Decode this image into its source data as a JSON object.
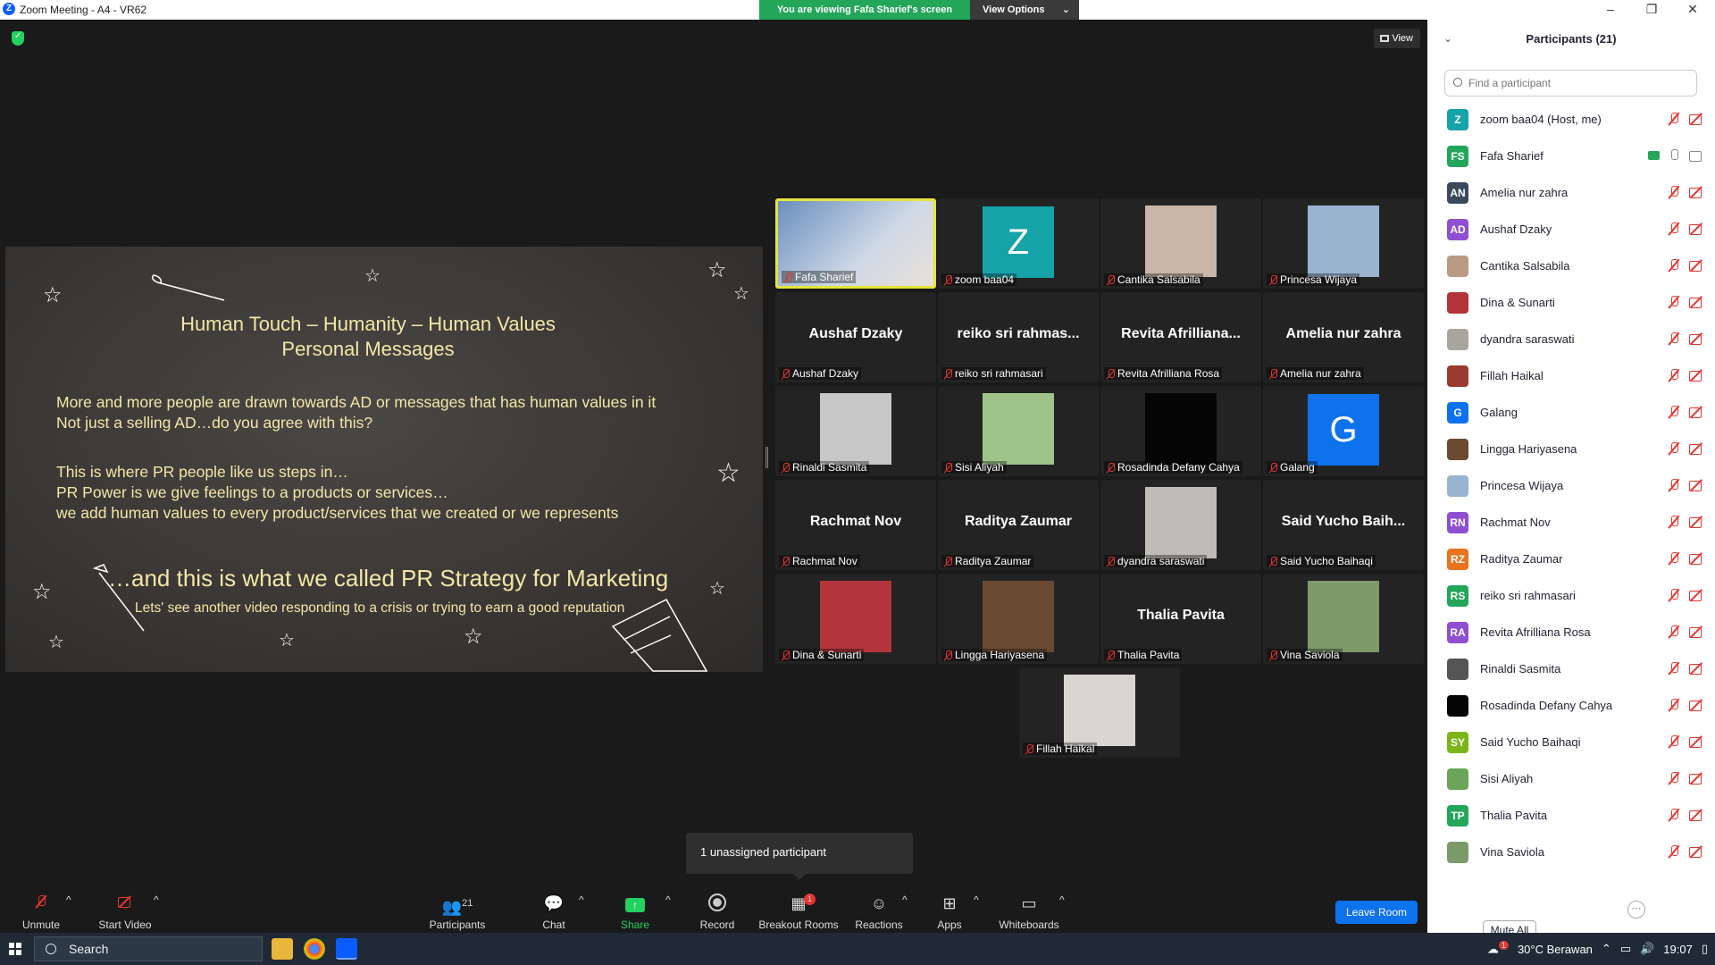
{
  "window": {
    "title": "Zoom Meeting - A4 - VR62",
    "logo_letter": "Z",
    "minimize": "–",
    "maximize": "❐",
    "close": "✕"
  },
  "viewing_banner": {
    "message": "You are viewing Fafa Sharief's screen",
    "options_label": "View Options",
    "chevron": "⌄"
  },
  "view_button": {
    "label": "View"
  },
  "slide": {
    "title_line1": "Human Touch – Humanity – Human Values",
    "title_line2": "Personal Messages",
    "para1_line1": "More and more people are drawn towards AD or messages that has human values in it",
    "para1_line2": "Not just a selling AD…do you agree with this?",
    "para2_line1": "This is where PR people like us steps in…",
    "para2_line2": "PR Power is we give feelings to a products or services…",
    "para2_line3": "we add human values to every product/services that we created or we represents",
    "headline": "…and this is what we called PR Strategy for Marketing",
    "subline": "Lets' see another video responding to a crisis or trying to earn a good reputation",
    "text_color": "#f3e7a6"
  },
  "gallery": [
    {
      "name": "Fafa Sharief",
      "kind": "video",
      "active": true,
      "color": "#6a8fbf"
    },
    {
      "name": "zoom baa04",
      "kind": "avatar",
      "letter": "Z",
      "color": "#16a3a8"
    },
    {
      "name": "Cantika Salsabila",
      "kind": "photo",
      "color": "#c9b6a8"
    },
    {
      "name": "Princesa Wijaya",
      "kind": "photo",
      "color": "#9ab3cf"
    },
    {
      "name": "Aushaf Dzaky",
      "kind": "text",
      "big": "Aushaf Dzaky"
    },
    {
      "name": "reiko sri rahmasari",
      "kind": "text",
      "big": "reiko sri rahmas..."
    },
    {
      "name": "Revita Afrilliana Rosa",
      "kind": "text",
      "big": "Revita Afrilliana..."
    },
    {
      "name": "Amelia nur zahra",
      "kind": "text",
      "big": "Amelia nur zahra"
    },
    {
      "name": "Rinaldi Sasmita",
      "kind": "photo",
      "color": "#c7c7c7"
    },
    {
      "name": "Sisi Aliyah",
      "kind": "photo",
      "color": "#9ec48a"
    },
    {
      "name": "Rosadinda Defany Cahya",
      "kind": "photo",
      "color": "#050505"
    },
    {
      "name": "Galang",
      "kind": "avatar",
      "letter": "G",
      "color": "#0e72ed"
    },
    {
      "name": "Rachmat Nov",
      "kind": "text",
      "big": "Rachmat Nov"
    },
    {
      "name": "Raditya Zaumar",
      "kind": "text",
      "big": "Raditya Zaumar"
    },
    {
      "name": "dyandra saraswati",
      "kind": "photo",
      "color": "#bfbcb7"
    },
    {
      "name": "Said Yucho Baihaqi",
      "kind": "text",
      "big": "Said Yucho Baih..."
    },
    {
      "name": "Dina & Sunarti",
      "kind": "photo",
      "color": "#b3343a"
    },
    {
      "name": "Lingga Hariyasena",
      "kind": "photo",
      "color": "#6b4a33"
    },
    {
      "name": "Thalia Pavita",
      "kind": "text",
      "big": "Thalia Pavita"
    },
    {
      "name": "Vina Saviola",
      "kind": "photo",
      "color": "#7d9a6a"
    },
    {
      "name": "Fillah Haikal",
      "kind": "photo",
      "color": "#d9d6d2"
    }
  ],
  "toast": {
    "text": "1 unassigned participant"
  },
  "toolbar": {
    "unmute": "Unmute",
    "start_video": "Start Video",
    "participants": "Participants",
    "participants_count": "21",
    "chat": "Chat",
    "share_screen": "Share Screen",
    "record": "Record",
    "breakout_rooms": "Breakout Rooms",
    "breakout_badge": "1",
    "reactions": "Reactions",
    "apps": "Apps",
    "whiteboards": "Whiteboards",
    "leave": "Leave Room",
    "caret": "^"
  },
  "participants_panel": {
    "title": "Participants (21)",
    "collapse": "⌄",
    "search_placeholder": "Find a participant",
    "mute_all": "Mute All",
    "more": "···",
    "list": [
      {
        "name": "zoom baa04 (Host, me)",
        "initials": "Z",
        "color": "#16a3a8",
        "mic": "off",
        "cam": "off"
      },
      {
        "name": "Fafa Sharief",
        "initials": "FS",
        "color": "#23a65a",
        "mic": "on",
        "cam": "on",
        "sharing": true
      },
      {
        "name": "Amelia nur zahra",
        "initials": "AN",
        "color": "#3a4a5c",
        "mic": "off",
        "cam": "off"
      },
      {
        "name": "Aushaf Dzaky",
        "initials": "AD",
        "color": "#8e4fd1",
        "mic": "off",
        "cam": "off"
      },
      {
        "name": "Cantika Salsabila",
        "initials": "",
        "color": "#b89a86",
        "mic": "off",
        "cam": "off"
      },
      {
        "name": "Dina & Sunarti",
        "initials": "",
        "color": "#b3343a",
        "mic": "off",
        "cam": "off"
      },
      {
        "name": "dyandra saraswati",
        "initials": "",
        "color": "#a8a59f",
        "mic": "off",
        "cam": "off"
      },
      {
        "name": "Fillah Haikal",
        "initials": "",
        "color": "#9a3a30",
        "mic": "off",
        "cam": "off"
      },
      {
        "name": "Galang",
        "initials": "G",
        "color": "#0e72ed",
        "mic": "off",
        "cam": "off"
      },
      {
        "name": "Lingga Hariyasena",
        "initials": "",
        "color": "#6b4a33",
        "mic": "off",
        "cam": "off"
      },
      {
        "name": "Princesa Wijaya",
        "initials": "",
        "color": "#9ab3cf",
        "mic": "off",
        "cam": "off"
      },
      {
        "name": "Rachmat Nov",
        "initials": "RN",
        "color": "#8e4fd1",
        "mic": "off",
        "cam": "off"
      },
      {
        "name": "Raditya Zaumar",
        "initials": "RZ",
        "color": "#e8731c",
        "mic": "off",
        "cam": "off"
      },
      {
        "name": "reiko sri rahmasari",
        "initials": "RS",
        "color": "#23a65a",
        "mic": "off",
        "cam": "off"
      },
      {
        "name": "Revita Afrilliana Rosa",
        "initials": "RA",
        "color": "#8e4fd1",
        "mic": "off",
        "cam": "off"
      },
      {
        "name": "Rinaldi Sasmita",
        "initials": "",
        "color": "#555555",
        "mic": "off",
        "cam": "off"
      },
      {
        "name": "Rosadinda Defany Cahya",
        "initials": "",
        "color": "#050505",
        "mic": "off",
        "cam": "off"
      },
      {
        "name": "Said Yucho Baihaqi",
        "initials": "SY",
        "color": "#7cb518",
        "mic": "off",
        "cam": "off"
      },
      {
        "name": "Sisi Aliyah",
        "initials": "",
        "color": "#6aa55a",
        "mic": "off",
        "cam": "off"
      },
      {
        "name": "Thalia Pavita",
        "initials": "TP",
        "color": "#23a65a",
        "mic": "off",
        "cam": "off"
      },
      {
        "name": "Vina Saviola",
        "initials": "",
        "color": "#7d9a6a",
        "mic": "off",
        "cam": "off"
      }
    ]
  },
  "taskbar": {
    "search_label": "Search",
    "weather": "30°C  Berawan",
    "time": "19:07",
    "weather_badge": "1"
  }
}
